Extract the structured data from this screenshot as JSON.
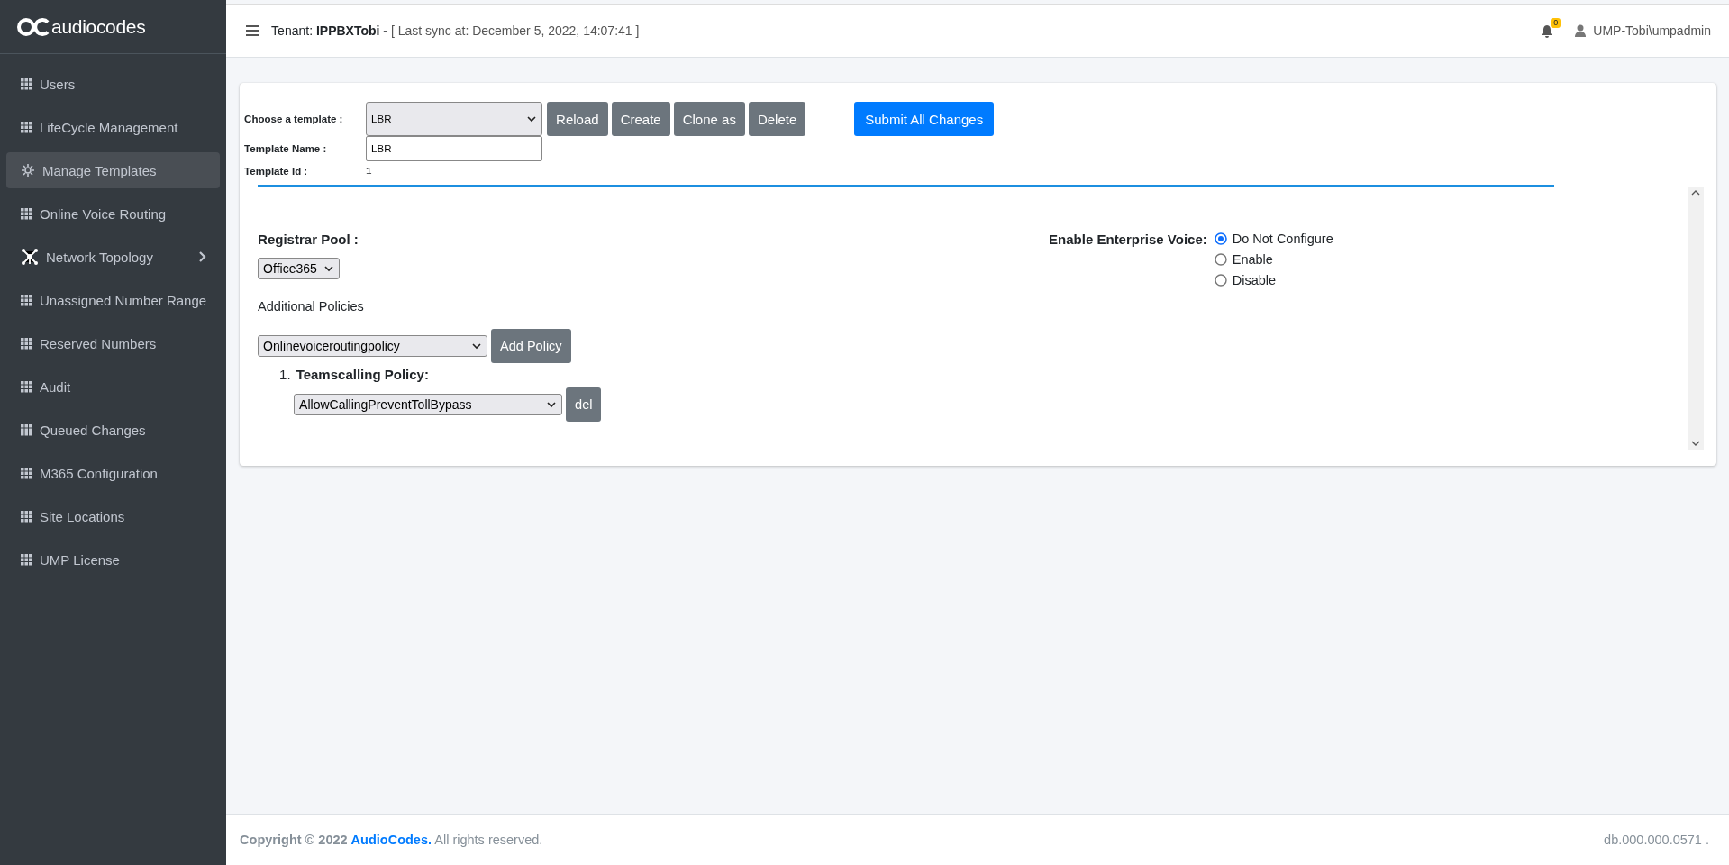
{
  "sidebar": {
    "logo": "audiocodes",
    "items": [
      {
        "label": "Users",
        "kind": "grid",
        "selected": false,
        "expandable": false
      },
      {
        "label": "LifeCycle Management",
        "kind": "grid",
        "selected": false,
        "expandable": false
      },
      {
        "label": "Manage Templates",
        "kind": "gear",
        "selected": true,
        "expandable": false
      },
      {
        "label": "Online Voice Routing",
        "kind": "grid",
        "selected": false,
        "expandable": false
      },
      {
        "label": "Network Topology",
        "kind": "network",
        "selected": false,
        "expandable": true
      },
      {
        "label": "Unassigned Number Range",
        "kind": "grid",
        "selected": false,
        "expandable": false
      },
      {
        "label": "Reserved Numbers",
        "kind": "grid",
        "selected": false,
        "expandable": false
      },
      {
        "label": "Audit",
        "kind": "grid",
        "selected": false,
        "expandable": false
      },
      {
        "label": "Queued Changes",
        "kind": "grid",
        "selected": false,
        "expandable": false
      },
      {
        "label": "M365 Configuration",
        "kind": "grid",
        "selected": false,
        "expandable": false
      },
      {
        "label": "Site Locations",
        "kind": "grid",
        "selected": false,
        "expandable": false
      },
      {
        "label": "UMP License",
        "kind": "grid",
        "selected": false,
        "expandable": false
      }
    ]
  },
  "header": {
    "tenant_label": "Tenant:",
    "tenant": "IPPBXTobi -",
    "sync": "[ Last sync at: December 5, 2022, 14:07:41 ]",
    "notifications": "0",
    "user": "UMP-Tobi\\umpadmin"
  },
  "template_bar": {
    "choose_label": "Choose a template :",
    "template": "LBR",
    "buttons": [
      {
        "label": "Reload",
        "kind": "secondary"
      },
      {
        "label": "Create",
        "kind": "secondary"
      },
      {
        "label": "Clone as",
        "kind": "secondary"
      },
      {
        "label": "Delete",
        "kind": "secondary"
      },
      {
        "label": "Submit All Changes",
        "kind": "primary"
      }
    ],
    "name_label": "Template Name :",
    "name_value": "LBR",
    "id_label": "Template Id :",
    "id_value": "1"
  },
  "settings": {
    "registrar_pool_label": "Registrar Pool :",
    "registrar_pool": "Office365",
    "additional_policies_label": "Additional Policies",
    "policy_select": "Onlinevoiceroutingpolicy",
    "add_button": "Add Policy",
    "policies": [
      {
        "number": "1.",
        "name": "Teamscalling Policy:",
        "value": "AllowCallingPreventTollBypass",
        "delete_button": "del"
      }
    ],
    "enterprise_voice_label": "Enable Enterprise Voice:",
    "enterprise_voice_options": [
      {
        "label": "Do Not Configure",
        "selected": true
      },
      {
        "label": "Enable",
        "selected": false
      },
      {
        "label": "Disable",
        "selected": false
      }
    ]
  },
  "footer": {
    "copyright": "Copyright © 2022",
    "company": "AudioCodes.",
    "rights": "All rights reserved.",
    "version": "db.000.000.0571 ."
  }
}
